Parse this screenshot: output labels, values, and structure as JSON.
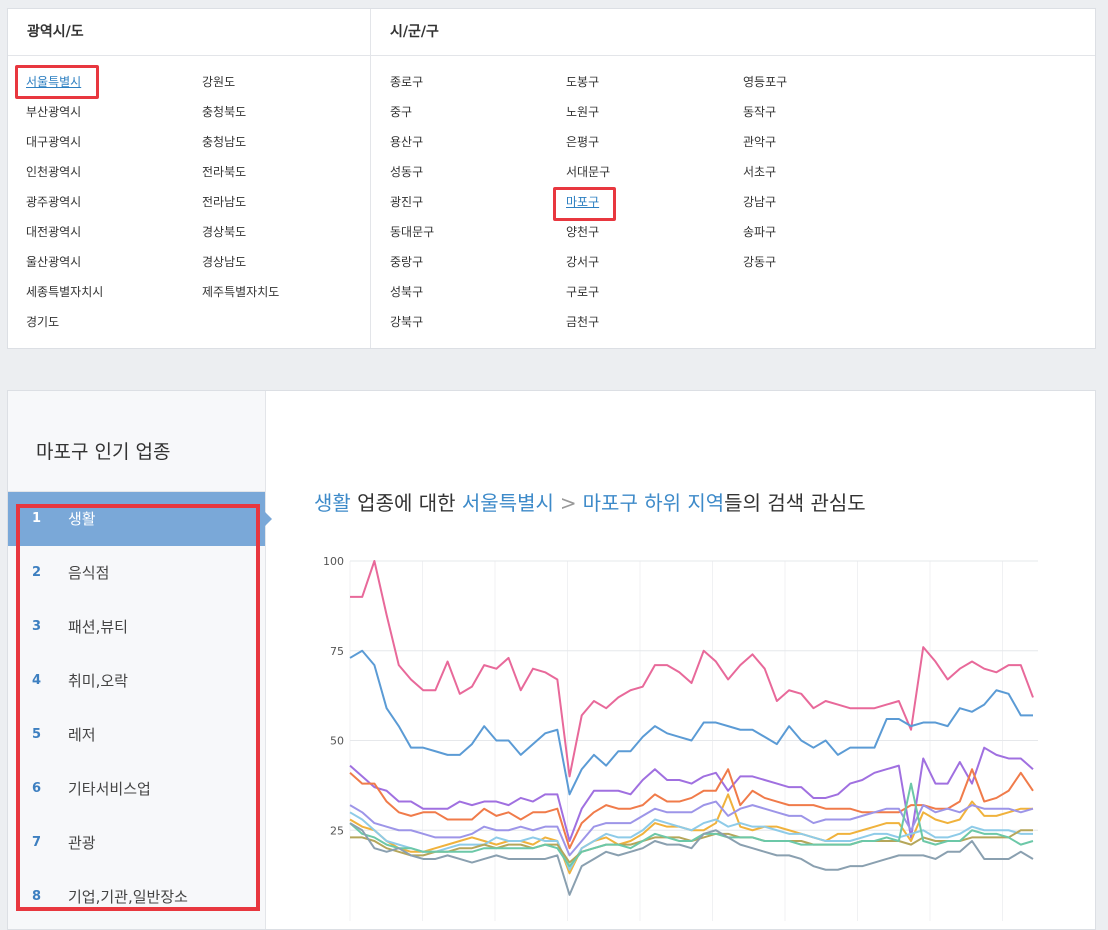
{
  "region": {
    "col1_header": "광역시/도",
    "col2_header": "시/군/구",
    "provinces": [
      "서울특별시",
      "부산광역시",
      "대구광역시",
      "인천광역시",
      "광주광역시",
      "대전광역시",
      "울산광역시",
      "세종특별자치시",
      "경기도",
      "강원도",
      "충청북도",
      "충청남도",
      "전라북도",
      "전라남도",
      "경상북도",
      "경상남도",
      "제주특별자치도"
    ],
    "selected_province": "서울특별시",
    "districts": [
      "종로구",
      "중구",
      "용산구",
      "성동구",
      "광진구",
      "동대문구",
      "중랑구",
      "성북구",
      "강북구",
      "도봉구",
      "노원구",
      "은평구",
      "서대문구",
      "마포구",
      "양천구",
      "강서구",
      "구로구",
      "금천구",
      "영등포구",
      "동작구",
      "관악구",
      "서초구",
      "강남구",
      "송파구",
      "강동구"
    ],
    "selected_district": "마포구"
  },
  "popular": {
    "title": "마포구 인기 업종",
    "items": [
      {
        "rank": "1",
        "label": "생활"
      },
      {
        "rank": "2",
        "label": "음식점"
      },
      {
        "rank": "3",
        "label": "패션,뷰티"
      },
      {
        "rank": "4",
        "label": "취미,오락"
      },
      {
        "rank": "5",
        "label": "레저"
      },
      {
        "rank": "6",
        "label": "기타서비스업"
      },
      {
        "rank": "7",
        "label": "관광"
      },
      {
        "rank": "8",
        "label": "기업,기관,일반장소"
      }
    ],
    "active_index": 0
  },
  "headline": {
    "category": "생활",
    "text1": " 업종에 대한 ",
    "province": "서울특별시",
    "chevron": ">",
    "district_part": "마포구 하위 지역",
    "text2": "들의 검색 관심도"
  },
  "chart_data": {
    "type": "line",
    "ylim": [
      0,
      100
    ],
    "yticks": [
      "100",
      "75",
      "50",
      "25"
    ],
    "series": [
      {
        "color": "#e8699a",
        "values": [
          90,
          90,
          100,
          85,
          71,
          67,
          64,
          64,
          72,
          63,
          65,
          71,
          70,
          73,
          64,
          70,
          69,
          67,
          40,
          57,
          61,
          59,
          62,
          64,
          65,
          71,
          71,
          69,
          66,
          75,
          72,
          67,
          71,
          74,
          70,
          61,
          64,
          63,
          59,
          61,
          60,
          59,
          59,
          59,
          60,
          61,
          53,
          76,
          72,
          67,
          70,
          72,
          70,
          69,
          71,
          71,
          62
        ]
      },
      {
        "color": "#5b9bd5",
        "values": [
          73,
          75,
          71,
          59,
          54,
          48,
          48,
          47,
          46,
          46,
          49,
          54,
          50,
          50,
          46,
          49,
          52,
          53,
          35,
          42,
          46,
          43,
          47,
          47,
          51,
          54,
          52,
          51,
          50,
          55,
          55,
          54,
          53,
          53,
          51,
          49,
          54,
          50,
          48,
          50,
          46,
          48,
          48,
          48,
          56,
          56,
          54,
          55,
          55,
          54,
          59,
          58,
          60,
          64,
          63,
          57,
          57
        ]
      },
      {
        "color": "#a070e0",
        "values": [
          43,
          40,
          37,
          36,
          33,
          33,
          31,
          31,
          31,
          33,
          32,
          33,
          33,
          32,
          34,
          33,
          35,
          35,
          22,
          31,
          36,
          36,
          36,
          35,
          39,
          42,
          39,
          39,
          38,
          40,
          41,
          36,
          40,
          40,
          39,
          38,
          37,
          37,
          34,
          34,
          35,
          38,
          39,
          41,
          42,
          43,
          23,
          45,
          38,
          38,
          44,
          38,
          48,
          46,
          45,
          45,
          42
        ]
      },
      {
        "color": "#f07b4a",
        "values": [
          41,
          38,
          38,
          33,
          30,
          29,
          30,
          30,
          28,
          28,
          28,
          31,
          29,
          30,
          28,
          30,
          30,
          31,
          20,
          27,
          30,
          32,
          31,
          31,
          32,
          35,
          33,
          33,
          34,
          36,
          36,
          42,
          32,
          36,
          34,
          33,
          32,
          32,
          32,
          31,
          31,
          31,
          30,
          30,
          30,
          30,
          32,
          32,
          31,
          31,
          33,
          42,
          33,
          34,
          36,
          41,
          36
        ]
      },
      {
        "color": "#f0b23c",
        "values": [
          28,
          26,
          25,
          22,
          20,
          19,
          19,
          20,
          21,
          22,
          23,
          22,
          21,
          22,
          22,
          21,
          23,
          22,
          13,
          20,
          22,
          23,
          21,
          22,
          24,
          27,
          26,
          26,
          25,
          25,
          27,
          35,
          26,
          25,
          26,
          26,
          25,
          24,
          23,
          22,
          24,
          24,
          25,
          26,
          27,
          27,
          22,
          30,
          28,
          27,
          28,
          33,
          29,
          29,
          30,
          31,
          31
        ]
      },
      {
        "color": "#9d95e8",
        "values": [
          32,
          30,
          27,
          26,
          25,
          25,
          24,
          23,
          23,
          23,
          24,
          26,
          25,
          25,
          26,
          25,
          26,
          26,
          18,
          22,
          26,
          27,
          27,
          27,
          29,
          31,
          30,
          30,
          30,
          32,
          33,
          29,
          31,
          32,
          31,
          30,
          29,
          29,
          27,
          28,
          28,
          28,
          29,
          30,
          31,
          31,
          25,
          32,
          30,
          31,
          30,
          32,
          31,
          31,
          31,
          30,
          31
        ]
      },
      {
        "color": "#8ecbe8",
        "values": [
          30,
          28,
          25,
          22,
          21,
          20,
          19,
          19,
          20,
          21,
          21,
          21,
          23,
          22,
          22,
          23,
          22,
          22,
          14,
          20,
          22,
          24,
          23,
          23,
          25,
          28,
          27,
          26,
          25,
          27,
          28,
          26,
          27,
          26,
          26,
          25,
          24,
          24,
          23,
          22,
          22,
          22,
          23,
          24,
          24,
          23,
          24,
          25,
          23,
          23,
          24,
          26,
          25,
          25,
          25,
          24,
          24
        ]
      },
      {
        "color": "#b5a65a",
        "values": [
          23,
          23,
          22,
          20,
          19,
          18,
          18,
          19,
          19,
          20,
          20,
          21,
          20,
          21,
          21,
          20,
          21,
          21,
          16,
          19,
          20,
          21,
          21,
          21,
          22,
          23,
          23,
          23,
          22,
          23,
          24,
          24,
          23,
          23,
          22,
          22,
          22,
          22,
          21,
          21,
          21,
          21,
          22,
          22,
          22,
          22,
          21,
          23,
          22,
          22,
          22,
          23,
          23,
          23,
          23,
          25,
          25
        ]
      },
      {
        "color": "#6cc8a8",
        "values": [
          27,
          24,
          23,
          21,
          20,
          20,
          19,
          19,
          19,
          19,
          19,
          20,
          20,
          20,
          20,
          20,
          21,
          20,
          15,
          19,
          20,
          21,
          21,
          20,
          22,
          24,
          23,
          22,
          22,
          24,
          24,
          23,
          23,
          23,
          22,
          22,
          22,
          21,
          21,
          21,
          21,
          21,
          22,
          22,
          23,
          22,
          38,
          22,
          21,
          22,
          22,
          25,
          24,
          24,
          23,
          21,
          22
        ]
      },
      {
        "color": "#8aa0b0",
        "values": [
          27,
          25,
          20,
          19,
          20,
          18,
          17,
          17,
          18,
          17,
          16,
          17,
          18,
          17,
          17,
          17,
          17,
          18,
          7,
          15,
          17,
          19,
          18,
          19,
          20,
          22,
          21,
          21,
          20,
          24,
          25,
          23,
          21,
          20,
          19,
          18,
          18,
          17,
          15,
          14,
          14,
          15,
          15,
          16,
          17,
          18,
          18,
          18,
          17,
          19,
          19,
          22,
          17,
          17,
          17,
          19,
          17
        ]
      }
    ]
  }
}
